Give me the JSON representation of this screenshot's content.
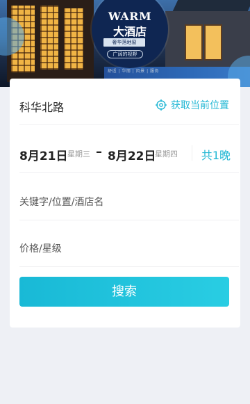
{
  "banner": {
    "brand_line1": "WARM",
    "brand_line2": "大酒店",
    "tag_primary": "奢华落地窗",
    "tag_secondary": "广阔的视野",
    "features": "舒适 | 华丽 | 风景 | 服务"
  },
  "search": {
    "location": "科华北路",
    "locate_label": "获取当前位置",
    "checkin": {
      "date": "8月21日",
      "weekday": "星期三"
    },
    "checkout": {
      "date": "8月22日",
      "weekday": "星期四"
    },
    "nights_label": "共1晚",
    "keyword_placeholder": "关键字/位置/酒店名",
    "price_star_placeholder": "价格/星级",
    "submit_label": "搜索"
  },
  "colors": {
    "accent": "#22b7d4",
    "background": "#eef0f5"
  }
}
